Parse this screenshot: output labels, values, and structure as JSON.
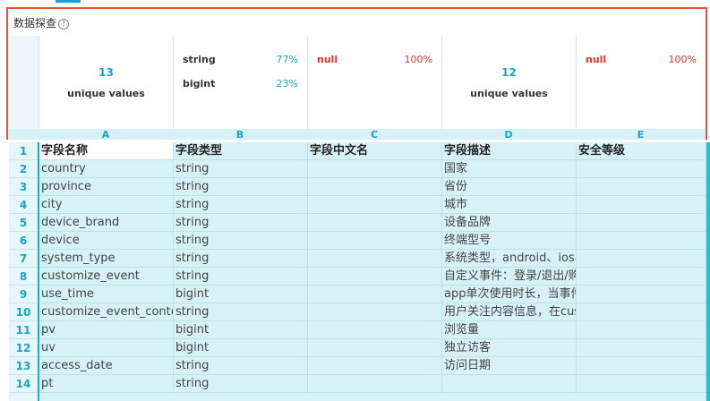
{
  "explore": {
    "title": "数据探查",
    "help_icon": "?",
    "cards": [
      {
        "type": "unique",
        "number": "13",
        "label": "unique values",
        "letter": "A"
      },
      {
        "type": "types",
        "rows": [
          {
            "name": "string",
            "pct": "77%"
          },
          {
            "name": "bigint",
            "pct": "23%"
          }
        ],
        "letter": "B"
      },
      {
        "type": "null",
        "rows": [
          {
            "name": "null",
            "pct": "100%"
          }
        ],
        "letter": "C"
      },
      {
        "type": "unique",
        "number": "12",
        "label": "unique values",
        "letter": "D"
      },
      {
        "type": "null",
        "rows": [
          {
            "name": "null",
            "pct": "100%"
          }
        ],
        "letter": "E"
      }
    ]
  },
  "grid": {
    "headers": [
      "字段名称",
      "字段类型",
      "字段中文名",
      "字段描述",
      "安全等级"
    ],
    "rows": [
      {
        "num": "1",
        "cells": [
          "字段名称",
          "字段类型",
          "字段中文名",
          "字段描述",
          "安全等级"
        ]
      },
      {
        "num": "2",
        "cells": [
          "country",
          "string",
          "",
          "国家",
          ""
        ]
      },
      {
        "num": "3",
        "cells": [
          "province",
          "string",
          "",
          "省份",
          ""
        ]
      },
      {
        "num": "4",
        "cells": [
          "city",
          "string",
          "",
          "城市",
          ""
        ]
      },
      {
        "num": "5",
        "cells": [
          "device_brand",
          "string",
          "",
          "设备品牌",
          ""
        ]
      },
      {
        "num": "6",
        "cells": [
          "device",
          "string",
          "",
          "终端型号",
          ""
        ]
      },
      {
        "num": "7",
        "cells": [
          "system_type",
          "string",
          "",
          "系统类型，android、ios、ipad、windows_phon",
          ""
        ]
      },
      {
        "num": "8",
        "cells": [
          "customize_event",
          "string",
          "",
          "自定义事件：登录/退出/购买/注册/点击/后台/",
          ""
        ]
      },
      {
        "num": "9",
        "cells": [
          "use_time",
          "bigint",
          "",
          "app单次使用时长，当事件为退出、后台、切换",
          ""
        ]
      },
      {
        "num": "10",
        "cells": [
          "customize_event_content",
          "string",
          "",
          "用户关注内容信息，在customize_event为浏览和",
          ""
        ]
      },
      {
        "num": "11",
        "cells": [
          "pv",
          "bigint",
          "",
          "浏览量",
          ""
        ]
      },
      {
        "num": "12",
        "cells": [
          "uv",
          "bigint",
          "",
          "独立访客",
          ""
        ]
      },
      {
        "num": "13",
        "cells": [
          "access_date",
          "string",
          "",
          "访问日期",
          ""
        ]
      },
      {
        "num": "14",
        "cells": [
          "pt",
          "string",
          "",
          "",
          ""
        ]
      }
    ]
  },
  "colors": {
    "accent": "#1aa3c8",
    "highlight_border": "#e8533f",
    "null_red": "#e8332b",
    "grid_bg": "#d7f2f6"
  }
}
